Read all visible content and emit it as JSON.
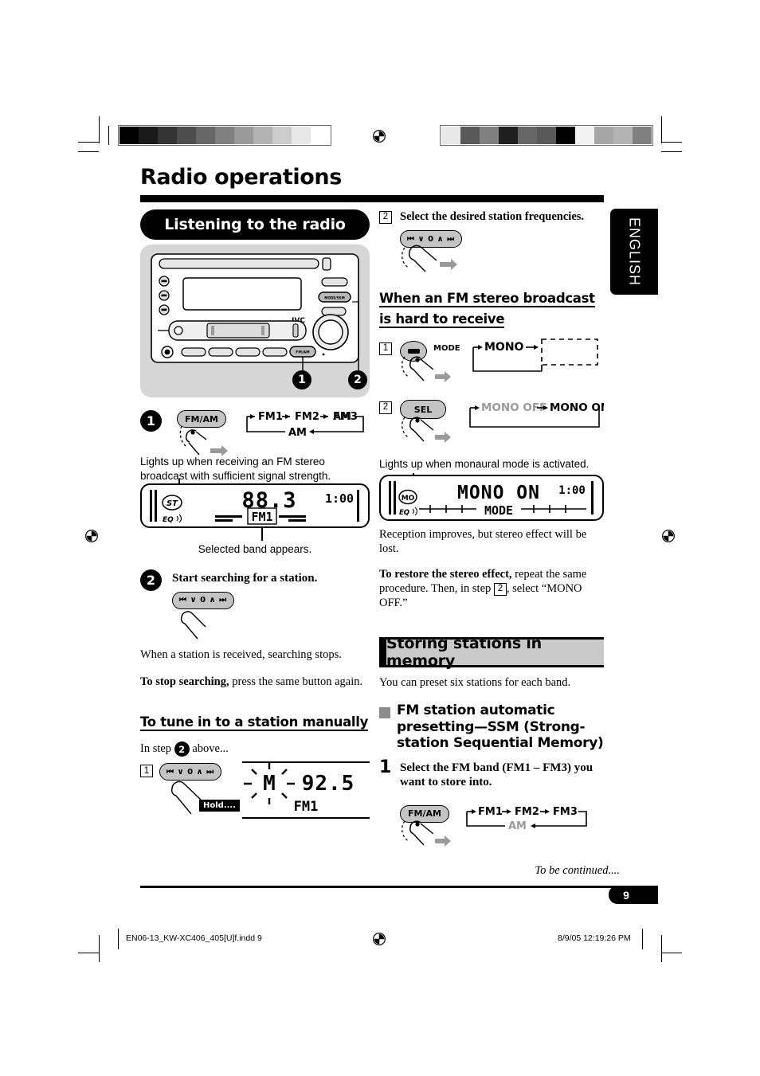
{
  "document": {
    "title": "Radio operations",
    "language_tab": "ENGLISH",
    "page_number": "9",
    "to_be_continued": "To be continued....",
    "footer_file": "EN06-13_KW-XC406_405[U]f.indd   9",
    "footer_timestamp": "8/9/05   12:19:26 PM"
  },
  "left_column": {
    "section_title": "Listening to the radio",
    "unit_callout_1": "1",
    "unit_callout_2": "2",
    "step1": {
      "number": "1",
      "button_label": "FM/AM",
      "flow": [
        "FM1",
        "FM2",
        "FM3",
        "AM"
      ],
      "note": "Lights up when receiving an FM stereo broadcast with sufficient signal strength.",
      "display": {
        "frequency": "88.3",
        "clock": "1:00",
        "stereo_indicator": "ST",
        "eq_indicator": "EQ",
        "band": "FM1"
      },
      "caption": "Selected band appears."
    },
    "step2": {
      "number": "2",
      "heading": "Start searching for a station.",
      "button_label": "⏮ ∨ 0 ∧ ⏭",
      "body_1": "When a station is received, searching stops.",
      "body_2_bold": "To stop searching,",
      "body_2_rest": " press the same button again."
    },
    "manual_tune": {
      "heading": "To tune in to a station manually",
      "intro_before": "In step ",
      "intro_step": "2",
      "intro_after": " above...",
      "substep": "1",
      "button_label": "⏮ ∨ 0 ∧ ⏭",
      "hold_label": "Hold....",
      "display": {
        "manual_indicator": "M",
        "frequency": "92.5",
        "band": "FM1"
      }
    }
  },
  "right_column": {
    "step2_top": {
      "number": "2",
      "heading": "Select the desired station frequencies.",
      "button_label": "⏮ ∨ 0 ∧ ⏭"
    },
    "fm_hard": {
      "heading": "When an FM stereo broadcast is hard to receive",
      "substep1": {
        "number": "1",
        "button_icon": "mode-button",
        "mode_label": "MODE",
        "flow_item": "MONO"
      },
      "substep2": {
        "number": "2",
        "button_label": "SEL",
        "flow_off": "MONO OFF",
        "flow_on": "MONO ON"
      },
      "note": "Lights up when monaural mode is activated.",
      "display": {
        "text": "MONO ON",
        "clock": "1:00",
        "mo_indicator": "MO",
        "eq_indicator": "EQ",
        "mode_label": "MODE"
      },
      "after_note": "Reception improves, but stereo effect will be lost.",
      "restore_bold": "To restore the stereo effect,",
      "restore_rest_1": " repeat the same procedure. Then, in step ",
      "restore_step": "2",
      "restore_rest_2": ", select “MONO OFF.”"
    },
    "storing": {
      "section_title": "Storing stations in memory",
      "intro": "You can preset six stations for each band.",
      "sub_heading": "FM station automatic presetting—SSM (Strong-station Sequential Memory)",
      "step1": {
        "number": "1",
        "heading": "Select the FM band (FM1 – FM3) you want to store into.",
        "button_label": "FM/AM",
        "flow": [
          "FM1",
          "FM2",
          "FM3",
          "AM"
        ]
      }
    }
  },
  "print_marks": {
    "left_strip": [
      "#000000",
      "#1a1a1a",
      "#333333",
      "#4d4d4d",
      "#666666",
      "#808080",
      "#999999",
      "#b3b3b3",
      "#cccccc",
      "#e8e8e8",
      "#ffffff"
    ],
    "right_strip": [
      "#e8e8e8",
      "#595959",
      "#808080",
      "#1f1f1f",
      "#666666",
      "#595959",
      "#000000",
      "#f2f2f2",
      "#a6a6a6",
      "#b3b3b3",
      "#808080"
    ]
  }
}
